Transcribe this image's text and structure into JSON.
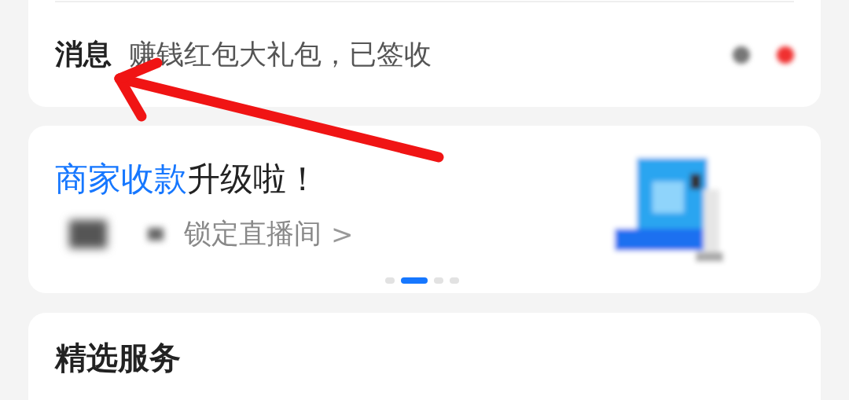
{
  "message_bar": {
    "title": "消息",
    "text": "赚钱红包大礼包，已签收"
  },
  "promo_card": {
    "headline_highlight": "商家收款",
    "headline_rest": "升级啦！",
    "link": "锁定直播间",
    "link_arrow": ">",
    "kind": "picture",
    "pager": [
      {
        "selected": false
      },
      {
        "selected": true
      },
      {
        "selected": false
      },
      {
        "selected": false
      }
    ]
  },
  "services_card": {
    "title": "精选服务"
  }
}
